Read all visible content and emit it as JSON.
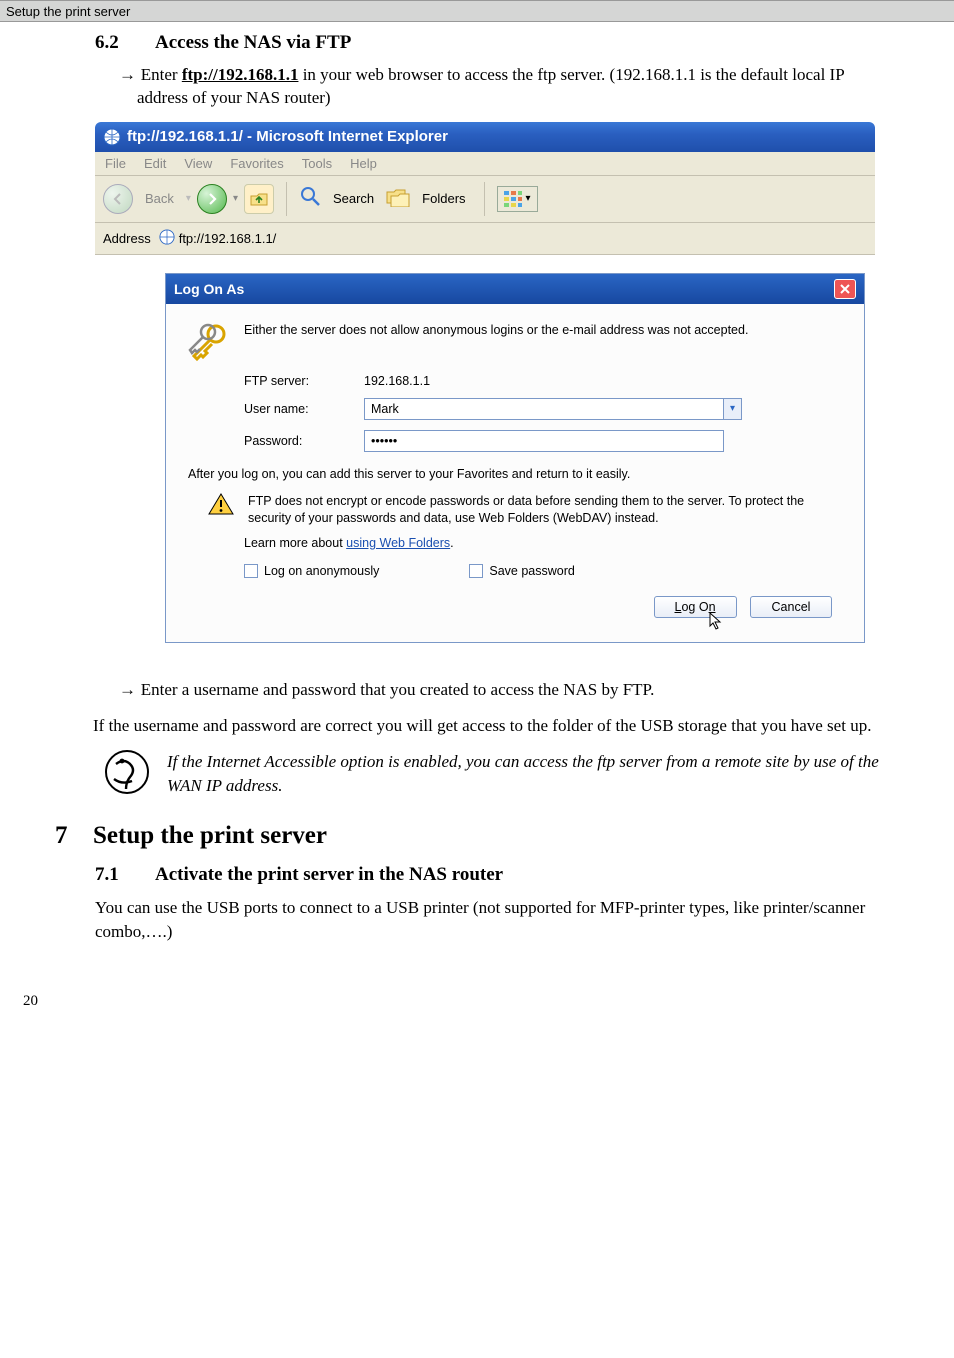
{
  "header": {
    "breadcrumb": "Setup the print server"
  },
  "section62": {
    "num": "6.2",
    "title": "Access the NAS via FTP",
    "instr_prefix": "Enter ",
    "instr_link": "ftp://192.168.1.1",
    "instr_suffix": " in your web browser to access the ftp server. (192.168.1.1 is the default local IP address of your NAS router)"
  },
  "ie": {
    "title": "ftp://192.168.1.1/ - Microsoft Internet Explorer",
    "menu": {
      "file": "File",
      "edit": "Edit",
      "view": "View",
      "favorites": "Favorites",
      "tools": "Tools",
      "help": "Help"
    },
    "toolbar": {
      "back": "Back",
      "search": "Search",
      "folders": "Folders"
    },
    "address_label": "Address",
    "address_value": "ftp://192.168.1.1/"
  },
  "dlg": {
    "title": "Log On As",
    "msg": "Either the server does not allow anonymous logins or the e-mail address was not accepted.",
    "ftp_label": "FTP server:",
    "ftp_value": "192.168.1.1",
    "user_label": "User name:",
    "user_value": "Mark",
    "pass_label": "Password:",
    "pass_value": "••••••",
    "after_text": "After you log on, you can add this server to your Favorites and return to it easily.",
    "warn_text": "FTP does not encrypt or encode passwords or data before sending them to the server.  To protect the security of your passwords and data, use Web Folders (WebDAV) instead.",
    "learn_prefix": "Learn more about ",
    "learn_link": "using Web Folders",
    "learn_suffix": ".",
    "cb_anon": "Log on anonymously",
    "cb_save": "Save password",
    "btn_logon": "Log On",
    "btn_cancel": "Cancel"
  },
  "after_dlg": {
    "instr": "Enter a username and password that you created to access the NAS by FTP.",
    "para": "If the username and password are correct you will get access to the folder of the USB storage that you have set up.",
    "tip": "If the Internet Accessible option is enabled, you can access the ftp server from a remote site by use of the WAN IP address."
  },
  "section7": {
    "num": "7",
    "title": "Setup the print server",
    "sub_num": "7.1",
    "sub_title": "Activate the print server in the NAS router",
    "para": "You can use the USB ports to connect to a USB printer (not supported for MFP-printer types, like printer/scanner combo,….)"
  },
  "page_num": "20"
}
